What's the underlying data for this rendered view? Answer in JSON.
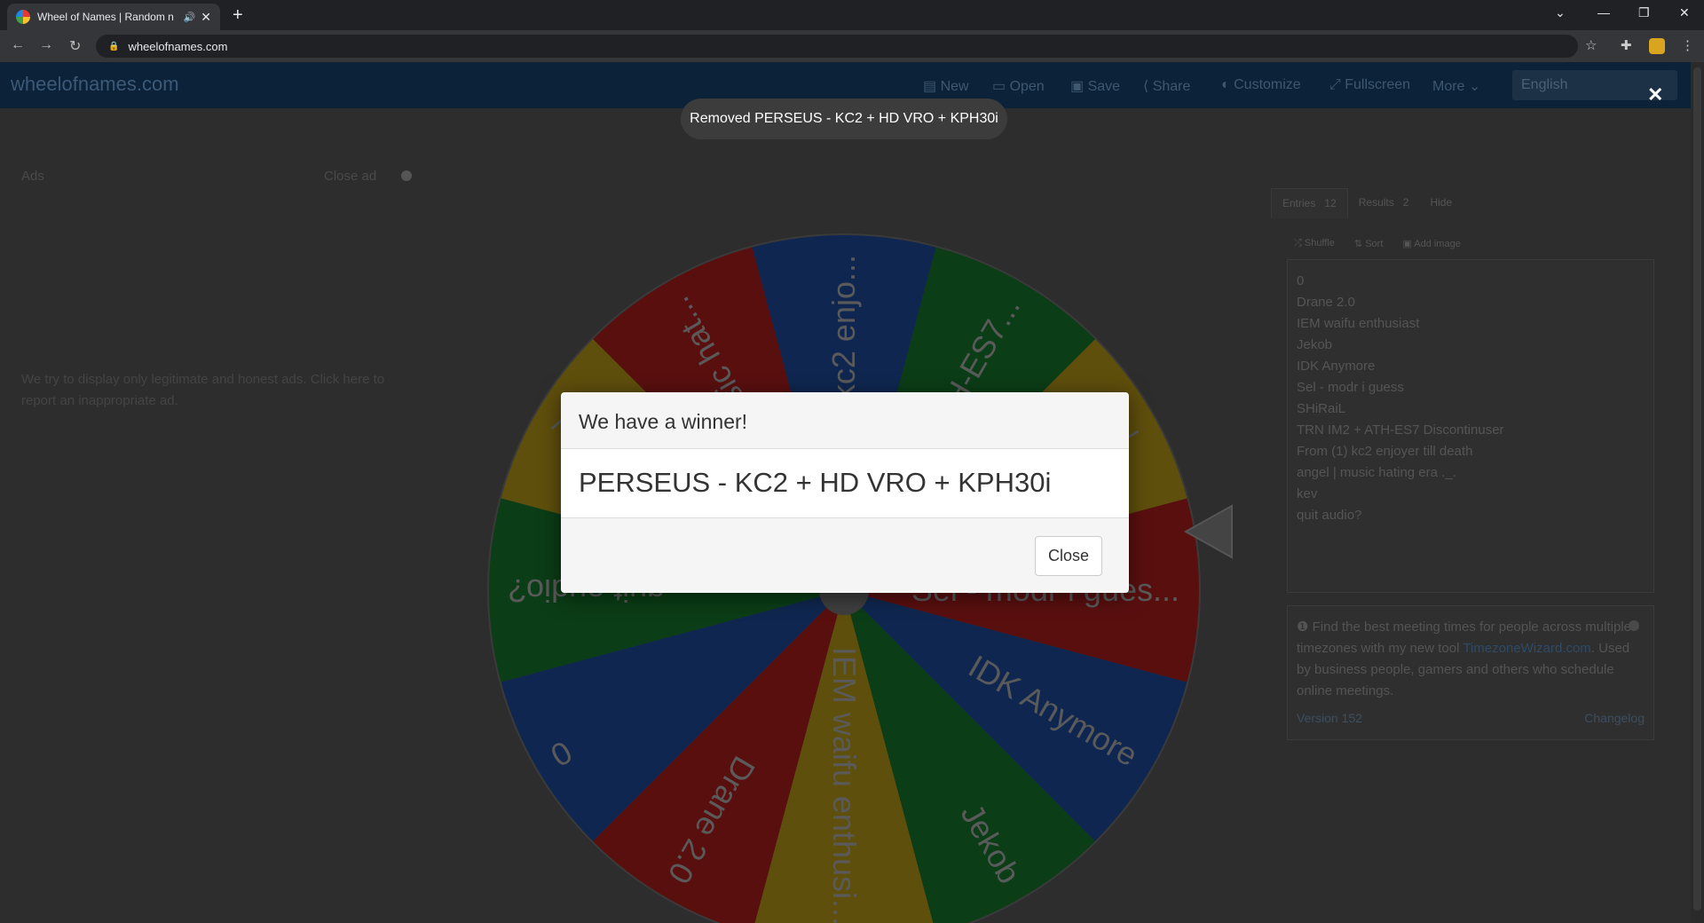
{
  "browser": {
    "tab_title": "Wheel of Names | Random n",
    "url": "wheelofnames.com",
    "new_tab": "+"
  },
  "appbar": {
    "brand": "wheelofnames.com",
    "menu": [
      "New",
      "Open",
      "Save",
      "Share",
      "Customize",
      "Fullscreen",
      "More"
    ],
    "language": "English"
  },
  "toast": "Removed PERSEUS - KC2 + HD VRO + KPH30i",
  "ads": {
    "label": "Ads",
    "close": "Close ad",
    "text": "We try to display only legitimate and honest ads. Click here to report an inappropriate ad."
  },
  "wheel": {
    "segments": [
      "IEM waifu enthusi...",
      "Jekob",
      "IDK Anymore",
      "Sel - modr i gues...",
      "SHiRaiL",
      "TRN IM2 + ATH-ES7...",
      "From (1) kc2 enjo...",
      "angel | music hat...",
      "kev",
      "quit audio?",
      "0",
      "Drane 2.0"
    ],
    "colors": [
      "#5f4f0c",
      "#0b3d16",
      "#0f2750",
      "#5a0f0f"
    ]
  },
  "sidebar": {
    "tabs": [
      {
        "label": "Entries",
        "count": "12"
      },
      {
        "label": "Results",
        "count": "2"
      },
      {
        "label": "Hide",
        "count": ""
      }
    ],
    "tools": [
      "Shuffle",
      "Sort",
      "Add image"
    ],
    "entries": [
      "0",
      "Drane 2.0",
      "IEM waifu enthusiast",
      "Jekob",
      "IDK Anymore",
      "Sel - modr i guess",
      "SHiRaiL",
      "TRN IM2 + ATH-ES7 Discontinuser",
      "From (1) kc2 enjoyer till death",
      "angel | music hating era ._.",
      "kev",
      "quit audio?"
    ],
    "info_pre": "Find the best meeting times for people across multiple timezones with my new tool ",
    "info_link": "TimezoneWizard.com",
    "info_post": ". Used by business people, gamers and others who schedule online meetings.",
    "version": "Version 152",
    "changelog": "Changelog"
  },
  "dialog": {
    "title": "We have a winner!",
    "winner": "PERSEUS - KC2 + HD VRO + KPH30i",
    "close": "Close"
  }
}
